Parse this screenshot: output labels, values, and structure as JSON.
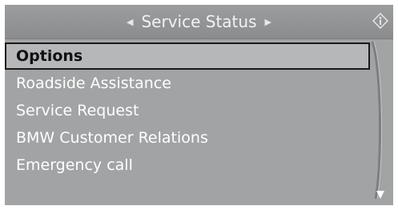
{
  "header": {
    "title": "Service Status",
    "left_arrow_icon": "triangle-left-icon",
    "right_arrow_icon": "triangle-right-icon",
    "info_icon": "info-icon"
  },
  "menu": {
    "items": [
      {
        "label": "Options",
        "selected": true
      },
      {
        "label": "Roadside Assistance",
        "selected": false
      },
      {
        "label": "Service Request",
        "selected": false
      },
      {
        "label": "BMW Customer Relations",
        "selected": false
      },
      {
        "label": "Emergency call",
        "selected": false
      }
    ]
  },
  "scroll": {
    "more_below_icon": "scroll-down-arrow-icon"
  },
  "colors": {
    "screen_background": "#a2a3a5",
    "header_background": "#919294",
    "text": "#ffffff",
    "selected_text": "#111111",
    "selected_border": "#1a1a1a"
  }
}
